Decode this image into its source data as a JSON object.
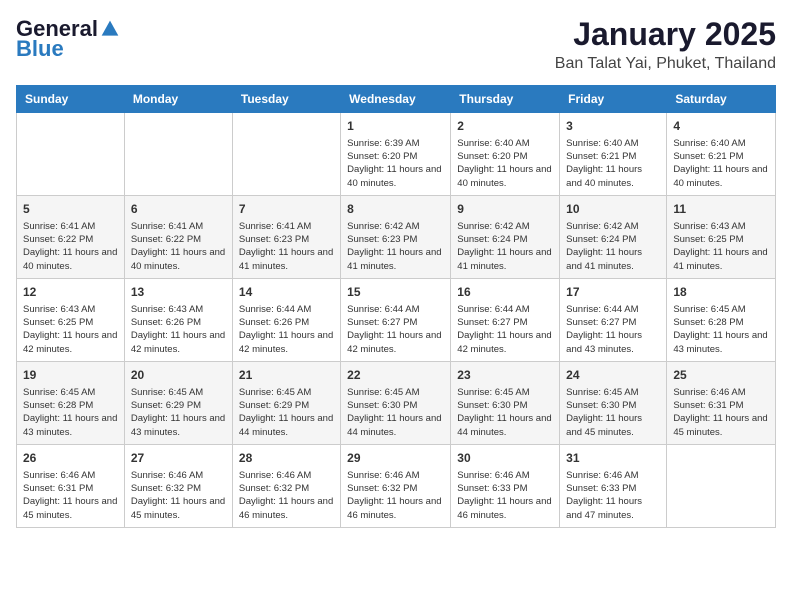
{
  "logo": {
    "general": "General",
    "blue": "Blue"
  },
  "title": {
    "month": "January 2025",
    "location": "Ban Talat Yai, Phuket, Thailand"
  },
  "days_of_week": [
    "Sunday",
    "Monday",
    "Tuesday",
    "Wednesday",
    "Thursday",
    "Friday",
    "Saturday"
  ],
  "weeks": [
    [
      {
        "day": "",
        "info": ""
      },
      {
        "day": "",
        "info": ""
      },
      {
        "day": "",
        "info": ""
      },
      {
        "day": "1",
        "info": "Sunrise: 6:39 AM\nSunset: 6:20 PM\nDaylight: 11 hours and 40 minutes."
      },
      {
        "day": "2",
        "info": "Sunrise: 6:40 AM\nSunset: 6:20 PM\nDaylight: 11 hours and 40 minutes."
      },
      {
        "day": "3",
        "info": "Sunrise: 6:40 AM\nSunset: 6:21 PM\nDaylight: 11 hours and 40 minutes."
      },
      {
        "day": "4",
        "info": "Sunrise: 6:40 AM\nSunset: 6:21 PM\nDaylight: 11 hours and 40 minutes."
      }
    ],
    [
      {
        "day": "5",
        "info": "Sunrise: 6:41 AM\nSunset: 6:22 PM\nDaylight: 11 hours and 40 minutes."
      },
      {
        "day": "6",
        "info": "Sunrise: 6:41 AM\nSunset: 6:22 PM\nDaylight: 11 hours and 40 minutes."
      },
      {
        "day": "7",
        "info": "Sunrise: 6:41 AM\nSunset: 6:23 PM\nDaylight: 11 hours and 41 minutes."
      },
      {
        "day": "8",
        "info": "Sunrise: 6:42 AM\nSunset: 6:23 PM\nDaylight: 11 hours and 41 minutes."
      },
      {
        "day": "9",
        "info": "Sunrise: 6:42 AM\nSunset: 6:24 PM\nDaylight: 11 hours and 41 minutes."
      },
      {
        "day": "10",
        "info": "Sunrise: 6:42 AM\nSunset: 6:24 PM\nDaylight: 11 hours and 41 minutes."
      },
      {
        "day": "11",
        "info": "Sunrise: 6:43 AM\nSunset: 6:25 PM\nDaylight: 11 hours and 41 minutes."
      }
    ],
    [
      {
        "day": "12",
        "info": "Sunrise: 6:43 AM\nSunset: 6:25 PM\nDaylight: 11 hours and 42 minutes."
      },
      {
        "day": "13",
        "info": "Sunrise: 6:43 AM\nSunset: 6:26 PM\nDaylight: 11 hours and 42 minutes."
      },
      {
        "day": "14",
        "info": "Sunrise: 6:44 AM\nSunset: 6:26 PM\nDaylight: 11 hours and 42 minutes."
      },
      {
        "day": "15",
        "info": "Sunrise: 6:44 AM\nSunset: 6:27 PM\nDaylight: 11 hours and 42 minutes."
      },
      {
        "day": "16",
        "info": "Sunrise: 6:44 AM\nSunset: 6:27 PM\nDaylight: 11 hours and 42 minutes."
      },
      {
        "day": "17",
        "info": "Sunrise: 6:44 AM\nSunset: 6:27 PM\nDaylight: 11 hours and 43 minutes."
      },
      {
        "day": "18",
        "info": "Sunrise: 6:45 AM\nSunset: 6:28 PM\nDaylight: 11 hours and 43 minutes."
      }
    ],
    [
      {
        "day": "19",
        "info": "Sunrise: 6:45 AM\nSunset: 6:28 PM\nDaylight: 11 hours and 43 minutes."
      },
      {
        "day": "20",
        "info": "Sunrise: 6:45 AM\nSunset: 6:29 PM\nDaylight: 11 hours and 43 minutes."
      },
      {
        "day": "21",
        "info": "Sunrise: 6:45 AM\nSunset: 6:29 PM\nDaylight: 11 hours and 44 minutes."
      },
      {
        "day": "22",
        "info": "Sunrise: 6:45 AM\nSunset: 6:30 PM\nDaylight: 11 hours and 44 minutes."
      },
      {
        "day": "23",
        "info": "Sunrise: 6:45 AM\nSunset: 6:30 PM\nDaylight: 11 hours and 44 minutes."
      },
      {
        "day": "24",
        "info": "Sunrise: 6:45 AM\nSunset: 6:30 PM\nDaylight: 11 hours and 45 minutes."
      },
      {
        "day": "25",
        "info": "Sunrise: 6:46 AM\nSunset: 6:31 PM\nDaylight: 11 hours and 45 minutes."
      }
    ],
    [
      {
        "day": "26",
        "info": "Sunrise: 6:46 AM\nSunset: 6:31 PM\nDaylight: 11 hours and 45 minutes."
      },
      {
        "day": "27",
        "info": "Sunrise: 6:46 AM\nSunset: 6:32 PM\nDaylight: 11 hours and 45 minutes."
      },
      {
        "day": "28",
        "info": "Sunrise: 6:46 AM\nSunset: 6:32 PM\nDaylight: 11 hours and 46 minutes."
      },
      {
        "day": "29",
        "info": "Sunrise: 6:46 AM\nSunset: 6:32 PM\nDaylight: 11 hours and 46 minutes."
      },
      {
        "day": "30",
        "info": "Sunrise: 6:46 AM\nSunset: 6:33 PM\nDaylight: 11 hours and 46 minutes."
      },
      {
        "day": "31",
        "info": "Sunrise: 6:46 AM\nSunset: 6:33 PM\nDaylight: 11 hours and 47 minutes."
      },
      {
        "day": "",
        "info": ""
      }
    ]
  ]
}
